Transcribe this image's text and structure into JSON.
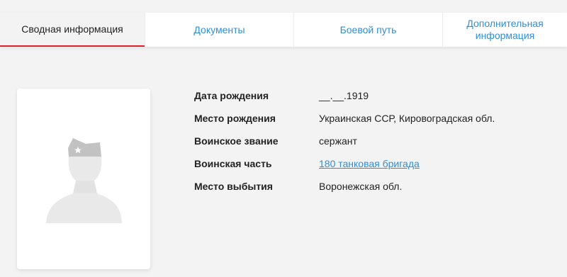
{
  "tabs": [
    {
      "label": "Сводная информация",
      "active": true
    },
    {
      "label": "Документы",
      "active": false
    },
    {
      "label": "Боевой путь",
      "active": false
    },
    {
      "label": "Дополнительная информация",
      "active": false
    }
  ],
  "photo": {
    "icon": "soldier-silhouette-icon"
  },
  "info": {
    "birth_date_label": "Дата рождения",
    "birth_date_value": "__.__.1919",
    "birth_place_label": "Место рождения",
    "birth_place_value": "Украинская ССР, Кировоградская обл.",
    "rank_label": "Воинское звание",
    "rank_value": "сержант",
    "unit_label": "Воинская часть",
    "unit_value": "180 танковая бригада",
    "departure_label": "Место выбытия",
    "departure_value": "Воронежская обл."
  },
  "colors": {
    "accent": "#d8232a",
    "link": "#2f8fd6"
  }
}
